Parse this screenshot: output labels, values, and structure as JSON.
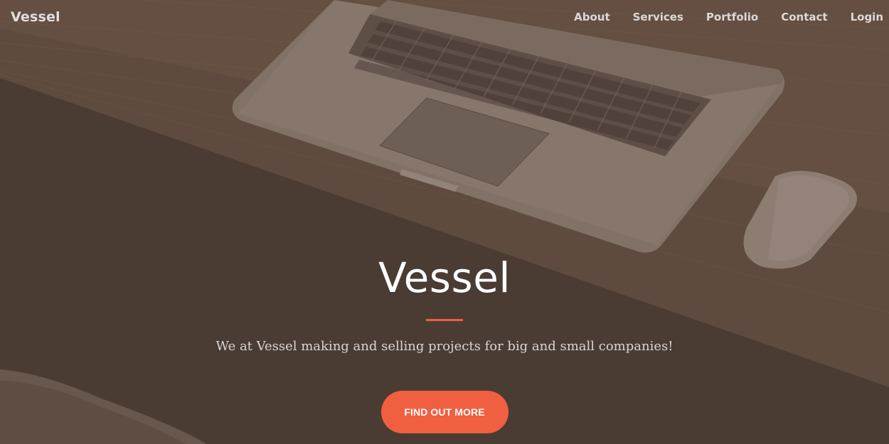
{
  "navbar": {
    "brand": "Vessel",
    "links": [
      {
        "label": "About"
      },
      {
        "label": "Services"
      },
      {
        "label": "Portfolio"
      },
      {
        "label": "Contact"
      },
      {
        "label": "Login"
      }
    ]
  },
  "hero": {
    "title": "Vessel",
    "subtitle": "We at Vessel making and selling projects for big and small companies!",
    "cta_label": "FIND OUT MORE"
  },
  "colors": {
    "accent": "#f05f40",
    "overlay": "#4c3d34",
    "text_light": "#ffffff"
  },
  "background": {
    "objects": [
      "laptop-icon",
      "mouse-icon",
      "wooden-desk",
      "chair"
    ]
  }
}
